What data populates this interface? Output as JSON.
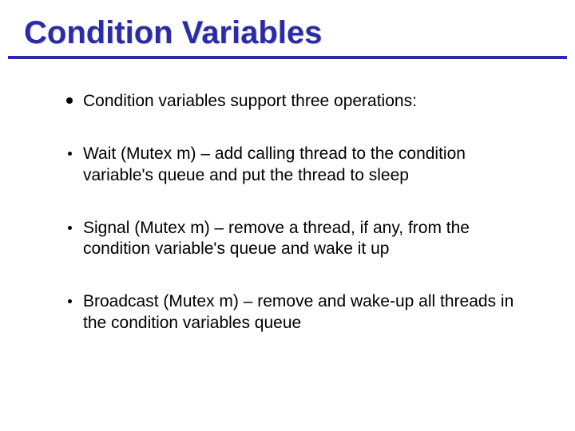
{
  "title": "Condition Variables",
  "items": [
    {
      "bullet": "disc",
      "text": "Condition variables support three operations:"
    },
    {
      "bullet": "dot",
      "text": "Wait (Mutex m) – add calling thread to the condition variable's queue and put the thread to sleep"
    },
    {
      "bullet": "dot",
      "text": "Signal (Mutex m) – remove a thread, if any, from the condition variable's queue and wake it up"
    },
    {
      "bullet": "dot",
      "text": "Broadcast (Mutex m) – remove and wake-up all threads in the  condition variables queue"
    }
  ]
}
